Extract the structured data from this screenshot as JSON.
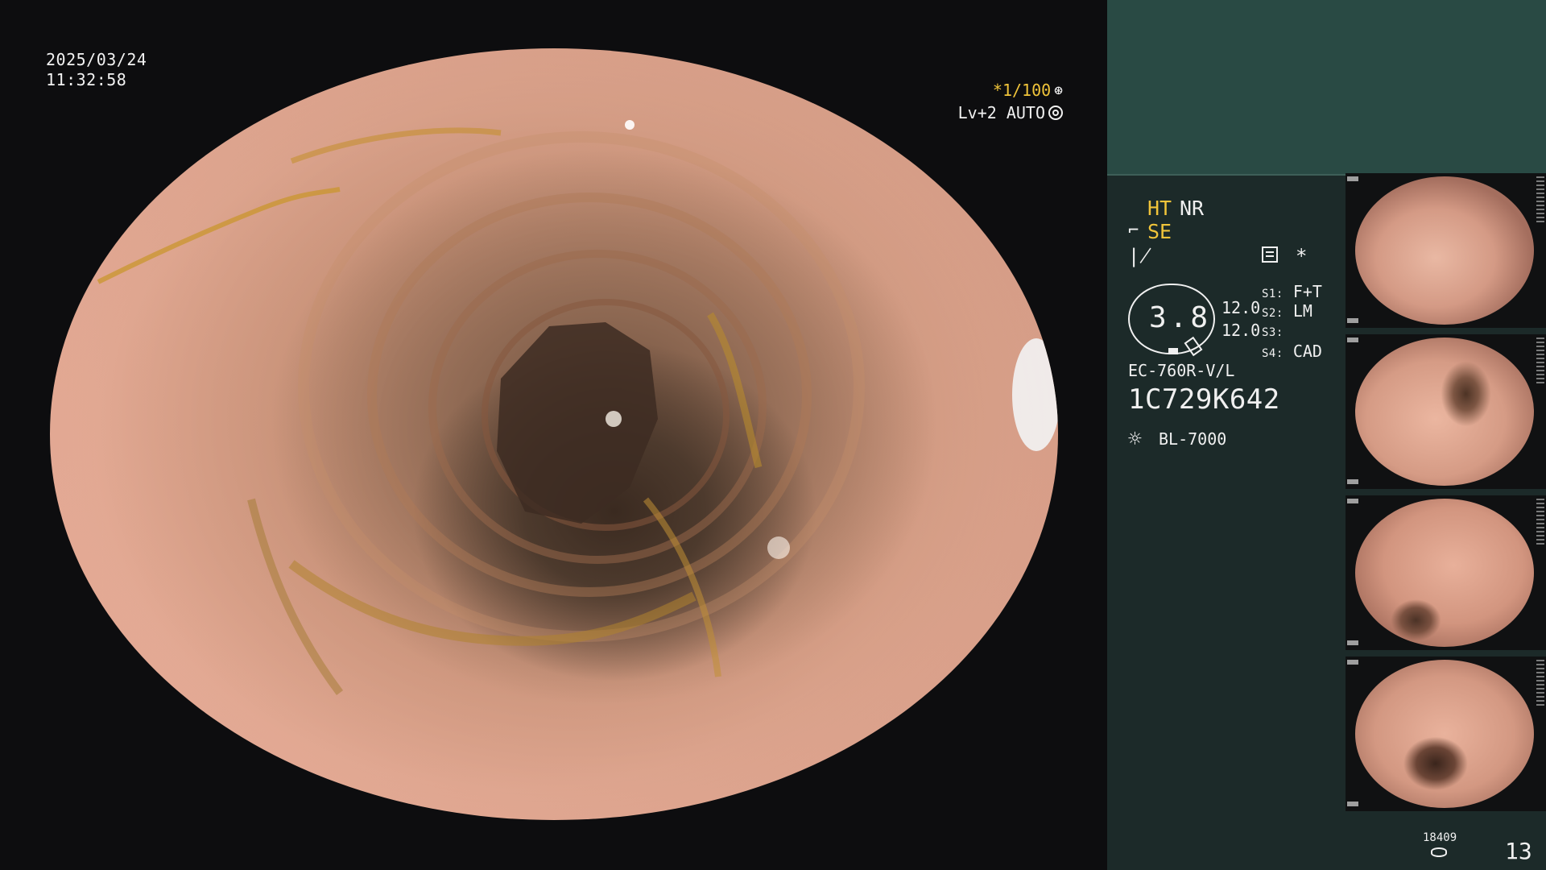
{
  "main_view": {
    "date": "2025/03/24",
    "time": "11:32:58",
    "shutter": "*1/100",
    "enhancement": "Lv+2 AUTO"
  },
  "info_panel": {
    "ht": "HT",
    "nr": "NR",
    "se": "SE",
    "star": "*",
    "level_value": "3.8",
    "value_1": "12.0",
    "value_2": "12.0",
    "switches": [
      {
        "key": "S1",
        "value": "F+T"
      },
      {
        "key": "S2",
        "value": "LM"
      },
      {
        "key": "S3",
        "value": ""
      },
      {
        "key": "S4",
        "value": "CAD"
      }
    ],
    "scope_model": "EC-760R-V/L",
    "scope_serial": "1C729K642",
    "light_source": "BL-7000",
    "footer_count": "18409",
    "footer_number": "13"
  },
  "colors": {
    "panel_background": "#1c2a29",
    "panel_header": "#294a44",
    "highlight_yellow": "#f0c43a",
    "text_white": "#f0f0f0"
  },
  "icons": {
    "shutter": "aperture-icon",
    "auto": "ring-icon",
    "se": "scope-tip-icon",
    "wave": "wave-icon",
    "grid": "settings-grid-icon",
    "light": "sun-icon",
    "storage": "disk-icon"
  }
}
